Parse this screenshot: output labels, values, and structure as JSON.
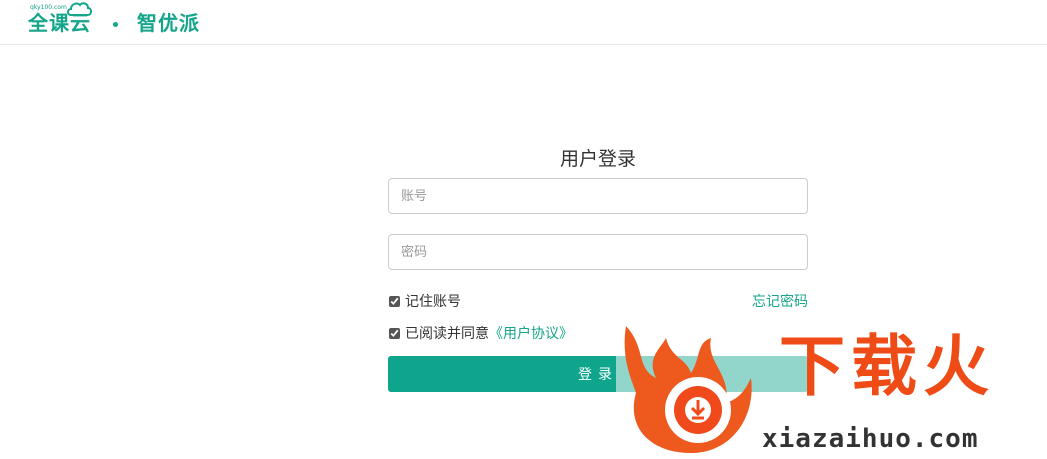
{
  "header": {
    "brand_main": "全课云",
    "brand_url": "qky100.com",
    "brand_sub": "智优派",
    "accent_color": "#14a58a"
  },
  "login": {
    "title": "用户登录",
    "account_placeholder": "账号",
    "password_placeholder": "密码",
    "remember_label": "记住账号",
    "remember_checked": true,
    "forgot_label": "忘记密码",
    "agree_prefix": "已阅读并同意",
    "agree_link": "《用户协议》",
    "agree_checked": true,
    "submit_label": "登录",
    "button_color": "#0fa58d"
  },
  "watermark": {
    "logo_text": "下载火",
    "url": "xiazaihuo.com",
    "color": "#ee4b16"
  }
}
